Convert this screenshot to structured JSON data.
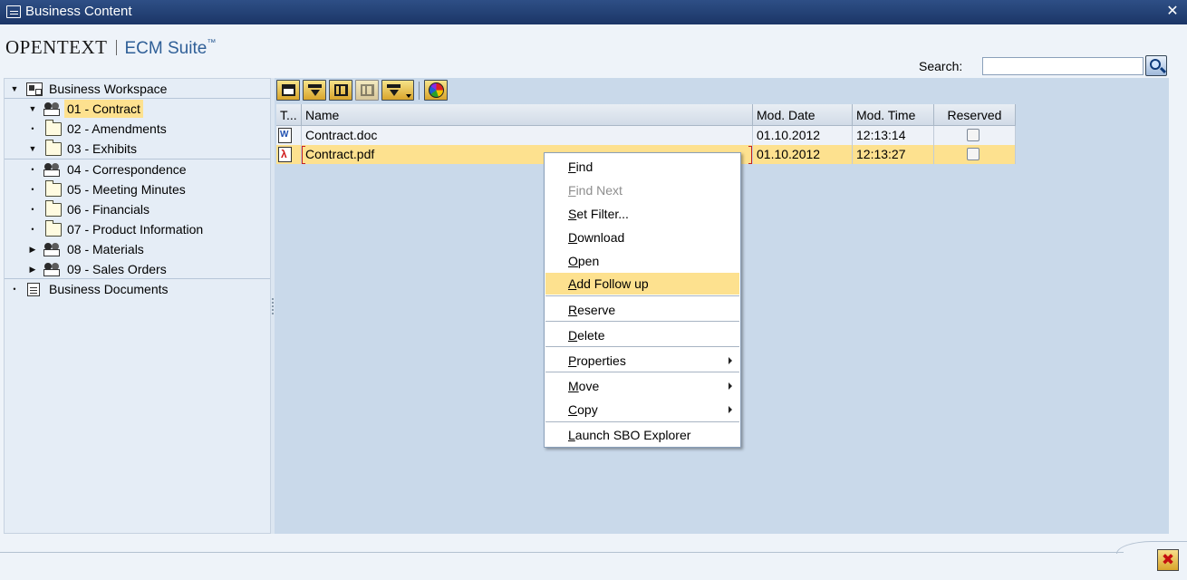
{
  "window": {
    "title": "Business Content",
    "close_glyph": "✕"
  },
  "logo": {
    "brand": "OPENTEXT",
    "product": "ECM Suite",
    "tm": "™"
  },
  "search": {
    "label": "Search:",
    "value": ""
  },
  "tree": {
    "items": [
      {
        "label": "Business Workspace",
        "expanded": true,
        "icon": "workspace-root-icon"
      },
      {
        "label": "01 - Contract",
        "expanded": true,
        "selected": true,
        "icon": "workspace-icon"
      },
      {
        "label": "02 - Amendments",
        "icon": "folder-icon"
      },
      {
        "label": "03 - Exhibits",
        "expanded": true,
        "icon": "folder-open-icon"
      },
      {
        "label": "04 - Correspondence",
        "icon": "workspace-icon"
      },
      {
        "label": "05 - Meeting Minutes",
        "icon": "folder-icon"
      },
      {
        "label": "06 - Financials",
        "icon": "folder-icon"
      },
      {
        "label": "07 - Product Information",
        "icon": "folder-icon"
      },
      {
        "label": "08 - Materials",
        "collapsed": true,
        "icon": "workspace-icon"
      },
      {
        "label": "09 - Sales Orders",
        "collapsed": true,
        "icon": "workspace-icon"
      },
      {
        "label": "Business Documents",
        "icon": "document-icon"
      }
    ]
  },
  "toolbar": {
    "buttons": [
      "print-icon",
      "filter-icon",
      "binoculars-icon",
      "add-icon",
      "filter-dropdown-icon",
      "chart-icon"
    ]
  },
  "table": {
    "headers": {
      "type": "T...",
      "name": "Name",
      "mod_date": "Mod. Date",
      "mod_time": "Mod. Time",
      "reserved": "Reserved"
    },
    "rows": [
      {
        "type_icon": "word-doc-icon",
        "name": "Contract.doc",
        "mod_date": "01.10.2012",
        "mod_time": "12:13:14",
        "reserved": false
      },
      {
        "type_icon": "pdf-doc-icon",
        "name": "Contract.pdf",
        "mod_date": "01.10.2012",
        "mod_time": "12:13:27",
        "reserved": false,
        "selected": true
      }
    ]
  },
  "context_menu": {
    "items": [
      {
        "mnemonic": "F",
        "rest": "ind"
      },
      {
        "mnemonic": "F",
        "rest": "ind Next",
        "disabled": true
      },
      {
        "mnemonic": "S",
        "rest": "et Filter..."
      },
      {
        "mnemonic": "D",
        "rest": "ownload"
      },
      {
        "mnemonic": "O",
        "rest": "pen"
      },
      {
        "mnemonic": "A",
        "rest": "dd Follow up",
        "hover": true
      },
      {
        "mnemonic": "R",
        "rest": "eserve"
      },
      {
        "mnemonic": "D",
        "rest": "elete"
      },
      {
        "mnemonic": "P",
        "rest": "roperties",
        "submenu": true
      },
      {
        "mnemonic": "M",
        "rest": "ove",
        "submenu": true
      },
      {
        "mnemonic": "C",
        "rest": "opy",
        "submenu": true
      },
      {
        "mnemonic": "L",
        "rest": "aunch SBO Explorer"
      }
    ]
  },
  "footer": {
    "cancel_glyph": "✖"
  },
  "colors": {
    "titlebar": "#1b3566",
    "selection": "#fde18f",
    "panel": "#c9d9ea",
    "tree_bg": "#e5edf6"
  }
}
